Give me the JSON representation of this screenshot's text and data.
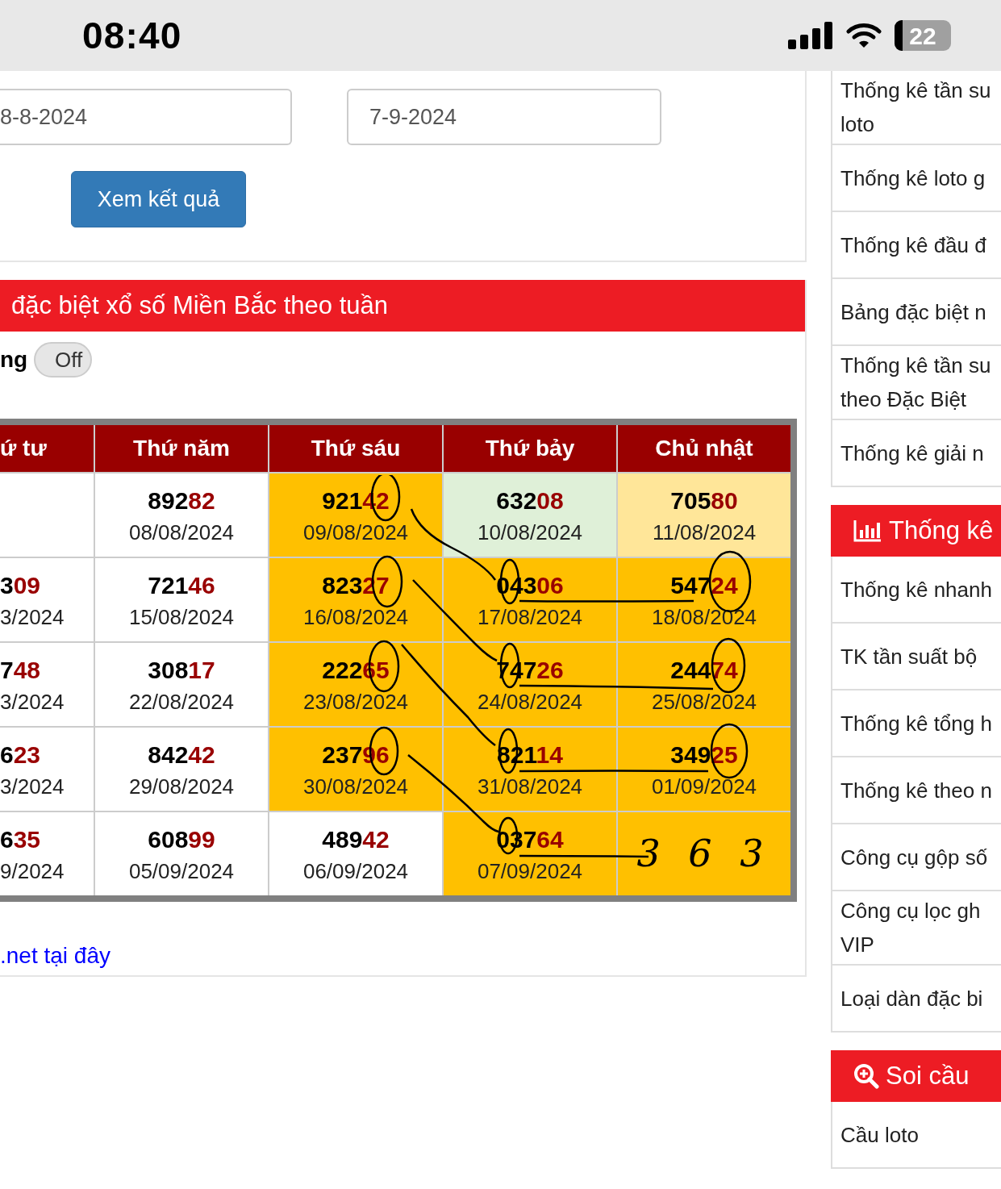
{
  "status_bar": {
    "time": "08:40",
    "battery": "22"
  },
  "form": {
    "from_date": "8-8-2024",
    "to_date": "7-9-2024",
    "submit": "Xem kết quả"
  },
  "title": "đặc biệt xổ số Miền Bắc theo tuần",
  "toggle": {
    "label": "ng",
    "text": "Off",
    "on": false
  },
  "table": {
    "columns": [
      "ứ tư",
      "Thứ năm",
      "Thứ sáu",
      "Thứ bảy",
      "Chủ nhật"
    ],
    "rows": [
      [
        {
          "color": "#ffffff"
        },
        {
          "head": "892",
          "tail": "82",
          "date": "08/08/2024",
          "color": "#ffffff"
        },
        {
          "head": "921",
          "tail": "42",
          "date": "09/08/2024",
          "color": "#ffc000"
        },
        {
          "head": "632",
          "tail": "08",
          "date": "10/08/2024",
          "color": "#dff0d8"
        },
        {
          "head": "705",
          "tail": "80",
          "date": "11/08/2024",
          "color": "#ffe699"
        }
      ],
      [
        {
          "head": "3",
          "tail": "09",
          "date": "3/2024",
          "color": "#ffffff"
        },
        {
          "head": "721",
          "tail": "46",
          "date": "15/08/2024",
          "color": "#ffffff"
        },
        {
          "head": "823",
          "tail": "27",
          "date": "16/08/2024",
          "color": "#ffc000"
        },
        {
          "head": "043",
          "tail": "06",
          "date": "17/08/2024",
          "color": "#ffc000"
        },
        {
          "head": "547",
          "tail": "24",
          "date": "18/08/2024",
          "color": "#ffc000"
        }
      ],
      [
        {
          "head": "7",
          "tail": "48",
          "date": "3/2024",
          "color": "#ffffff"
        },
        {
          "head": "308",
          "tail": "17",
          "date": "22/08/2024",
          "color": "#ffffff"
        },
        {
          "head": "222",
          "tail": "65",
          "date": "23/08/2024",
          "color": "#ffc000"
        },
        {
          "head": "747",
          "tail": "26",
          "date": "24/08/2024",
          "color": "#ffc000"
        },
        {
          "head": "244",
          "tail": "74",
          "date": "25/08/2024",
          "color": "#ffc000"
        }
      ],
      [
        {
          "head": "6",
          "tail": "23",
          "date": "3/2024",
          "color": "#ffffff"
        },
        {
          "head": "842",
          "tail": "42",
          "date": "29/08/2024",
          "color": "#ffffff"
        },
        {
          "head": "237",
          "tail": "96",
          "date": "30/08/2024",
          "color": "#ffc000"
        },
        {
          "head": "821",
          "tail": "14",
          "date": "31/08/2024",
          "color": "#ffc000"
        },
        {
          "head": "349",
          "tail": "25",
          "date": "01/09/2024",
          "color": "#ffc000"
        }
      ],
      [
        {
          "head": "6",
          "tail": "35",
          "date": "9/2024",
          "color": "#ffffff"
        },
        {
          "head": "608",
          "tail": "99",
          "date": "05/09/2024",
          "color": "#ffffff"
        },
        {
          "head": "489",
          "tail": "42",
          "date": "06/09/2024",
          "color": "#ffffff"
        },
        {
          "head": "037",
          "tail": "64",
          "date": "07/09/2024",
          "color": "#ffc000"
        },
        {
          "note": "3 6 3",
          "color": "#ffc000"
        }
      ]
    ]
  },
  "link": ".net tại đây",
  "sidebar": [
    {
      "items": [
        [
          "Thống kê tần su",
          "loto"
        ],
        [
          "Thống kê loto g"
        ],
        [
          "Thống kê đầu đ"
        ],
        [
          "Bảng đặc biệt n"
        ],
        [
          "Thống kê tần su",
          "theo Đặc Biệt"
        ],
        [
          "Thống kê giải n"
        ]
      ]
    },
    {
      "header": "Thống kê",
      "items": [
        [
          "Thống kê nhanh"
        ],
        [
          "TK tần suất bộ"
        ],
        [
          "Thống kê tổng h"
        ],
        [
          "Thống kê theo n"
        ],
        [
          "Công cụ gộp số"
        ],
        [
          "Công cụ lọc gh",
          "VIP"
        ],
        [
          "Loại dàn đặc bi"
        ]
      ]
    },
    {
      "header": "Soi cầu",
      "items": [
        [
          "Cầu loto"
        ]
      ]
    }
  ]
}
